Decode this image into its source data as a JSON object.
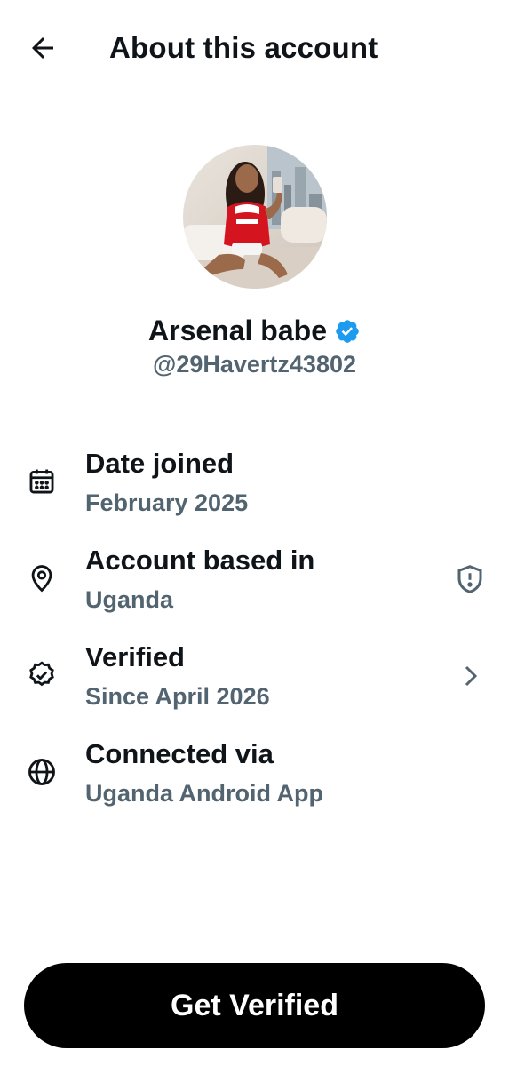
{
  "header": {
    "title": "About this account",
    "back_icon": "arrow-left-icon"
  },
  "profile": {
    "name": "Arsenal babe",
    "handle": "@29Havertz43802",
    "verified": true,
    "badge_color": "#1d9bf0"
  },
  "info": [
    {
      "icon": "calendar-icon",
      "label": "Date joined",
      "value": "February 2025"
    },
    {
      "icon": "location-pin-icon",
      "label": "Account based in",
      "value": "Uganda",
      "trailing_icon": "shield-alert-icon"
    },
    {
      "icon": "verified-outline-icon",
      "label": "Verified",
      "value": "Since April 2026",
      "trailing_icon": "chevron-right-icon"
    },
    {
      "icon": "globe-icon",
      "label": "Connected via",
      "value": "Uganda Android App"
    }
  ],
  "cta": {
    "label": "Get Verified"
  },
  "colors": {
    "text_primary": "#0f1419",
    "text_secondary": "#536471",
    "cta_bg": "#000000",
    "cta_text": "#ffffff"
  }
}
